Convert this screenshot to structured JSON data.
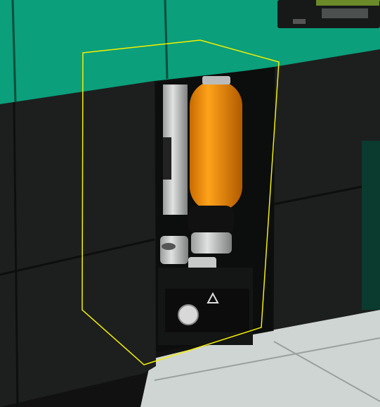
{
  "scene": {
    "colors": {
      "wall_upper": "#0a9e7a",
      "wall_lower": "#1c1e1e",
      "floor": "#d4dad8",
      "canister": "#f08a00",
      "selection_outline": "#f5f000"
    },
    "icons": [
      "warning-triangle-icon",
      "pressure-gauge-icon"
    ],
    "selection_active": true
  }
}
